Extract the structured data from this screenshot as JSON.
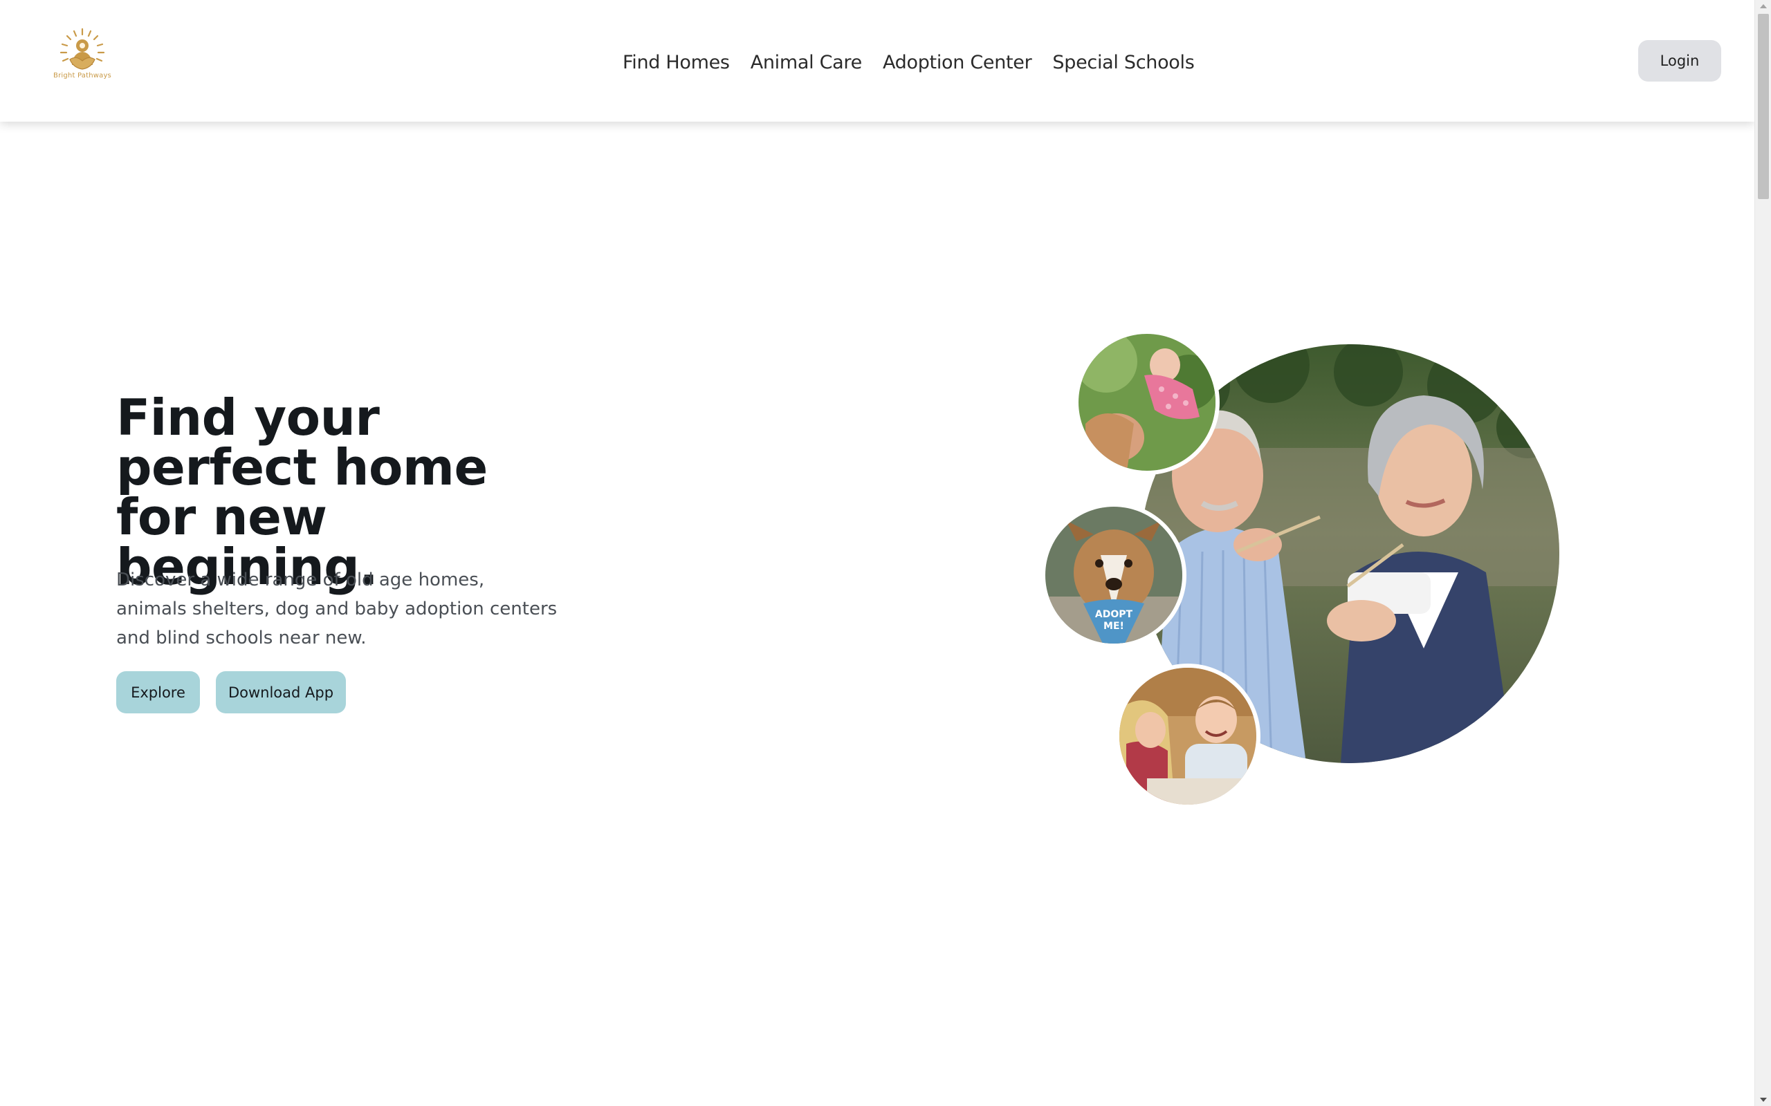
{
  "brand": {
    "name": "Bright Pathways",
    "logo_color": "#c99a48"
  },
  "nav": {
    "items": [
      {
        "label": "Find Homes"
      },
      {
        "label": "Animal Care"
      },
      {
        "label": "Adoption Center"
      },
      {
        "label": "Special Schools"
      }
    ]
  },
  "header": {
    "login_label": "Login"
  },
  "hero": {
    "title": "Find your perfect home for new begining.",
    "description": "Discover a wide range of old age homes, animals shelters, dog and baby adoption centers and blind schools near new.",
    "explore_label": "Explore",
    "download_label": "Download App"
  },
  "dog_bandana": {
    "line1": "ADOPT",
    "line2": "ME!"
  },
  "colors": {
    "button_bg": "#a8d4da",
    "login_bg": "#e0e1e5",
    "title": "#15191d"
  }
}
